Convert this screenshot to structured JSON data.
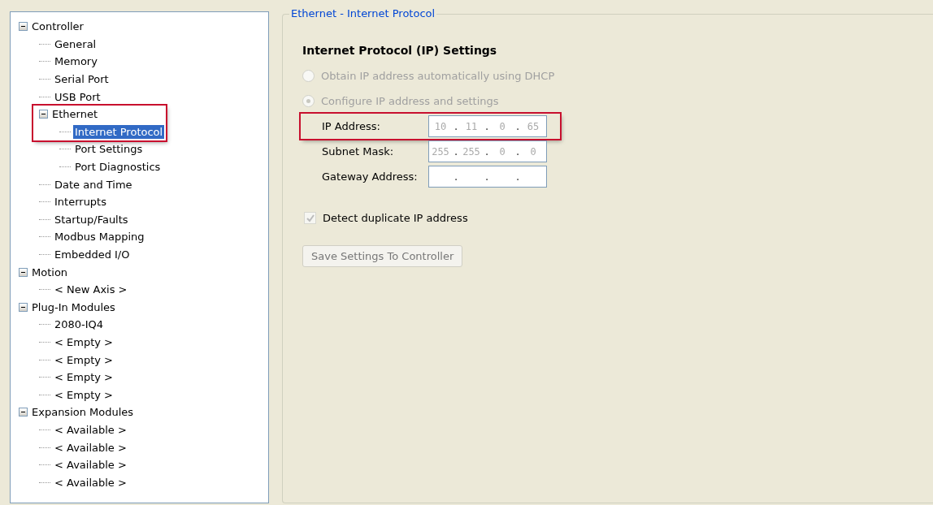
{
  "tree": {
    "items": [
      {
        "label": "Controller",
        "expanded": true,
        "selected": false,
        "children": [
          {
            "label": "General",
            "selected": false
          },
          {
            "label": "Memory",
            "selected": false
          },
          {
            "label": "Serial Port",
            "selected": false
          },
          {
            "label": "USB Port",
            "selected": false
          },
          {
            "label": "Ethernet",
            "expanded": true,
            "selected": false,
            "highlighted": true,
            "children": [
              {
                "label": "Internet Protocol",
                "selected": true,
                "highlighted": true
              },
              {
                "label": "Port Settings",
                "selected": false
              },
              {
                "label": "Port Diagnostics",
                "selected": false
              }
            ]
          },
          {
            "label": "Date and Time",
            "selected": false
          },
          {
            "label": "Interrupts",
            "selected": false
          },
          {
            "label": "Startup/Faults",
            "selected": false
          },
          {
            "label": "Modbus Mapping",
            "selected": false
          },
          {
            "label": "Embedded I/O",
            "selected": false
          }
        ]
      },
      {
        "label": "Motion",
        "expanded": true,
        "selected": false,
        "children": [
          {
            "label": "< New Axis >",
            "selected": false
          }
        ]
      },
      {
        "label": "Plug-In Modules",
        "expanded": true,
        "selected": false,
        "children": [
          {
            "label": "2080-IQ4",
            "selected": false
          },
          {
            "label": "< Empty >",
            "selected": false
          },
          {
            "label": "< Empty >",
            "selected": false
          },
          {
            "label": "< Empty >",
            "selected": false
          },
          {
            "label": "< Empty >",
            "selected": false
          }
        ]
      },
      {
        "label": "Expansion Modules",
        "expanded": true,
        "selected": false,
        "children": [
          {
            "label": "< Available >",
            "selected": false
          },
          {
            "label": "< Available >",
            "selected": false
          },
          {
            "label": "< Available >",
            "selected": false
          },
          {
            "label": "< Available >",
            "selected": false
          }
        ]
      }
    ]
  },
  "panel": {
    "title": "Ethernet - Internet Protocol",
    "heading": "Internet Protocol (IP) Settings",
    "radios": [
      {
        "label": "Obtain IP address automatically using DHCP",
        "selected": false,
        "disabled": true
      },
      {
        "label": "Configure IP address and settings",
        "selected": true,
        "disabled": true
      }
    ],
    "fields": [
      {
        "label": "IP Address:",
        "highlighted": true,
        "octets": [
          "10",
          "11",
          "0",
          "65"
        ],
        "separators": [
          ".",
          ".",
          "."
        ]
      },
      {
        "label": "Subnet Mask:",
        "highlighted": false,
        "octets": [
          "255",
          "255",
          "0",
          "0"
        ],
        "separators": [
          ".",
          ".",
          "."
        ]
      },
      {
        "label": "Gateway Address:",
        "highlighted": false,
        "separators": [
          ".",
          ".",
          "."
        ]
      }
    ],
    "checkbox": {
      "label": "Detect duplicate IP address",
      "checked": true,
      "disabled": true
    },
    "button": {
      "label": "Save Settings To Controller",
      "disabled": true
    }
  }
}
